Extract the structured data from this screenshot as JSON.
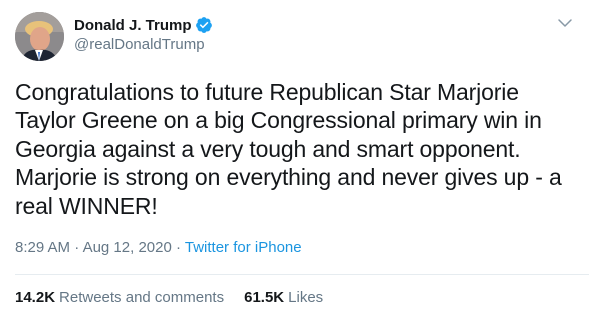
{
  "user": {
    "display_name": "Donald J. Trump",
    "handle": "@realDonaldTrump",
    "verified_icon": "verified-badge-icon",
    "avatar_icon": "profile-avatar"
  },
  "tweet": {
    "text": "Congratulations to future Republican Star Marjorie\nTaylor Greene on a big Congressional primary win in\nGeorgia against a very tough and smart opponent.\nMarjorie is strong on everything and never gives up - a\nreal WINNER!"
  },
  "meta": {
    "time": "8:29 AM",
    "separator": " · ",
    "date": "Aug 12, 2020",
    "source": "Twitter for iPhone"
  },
  "stats": {
    "retweets_count": "14.2K",
    "retweets_label": "Retweets and comments",
    "likes_count": "61.5K",
    "likes_label": "Likes"
  },
  "colors": {
    "accent": "#1b95e0",
    "secondary_text": "#657786",
    "primary_text": "#14171a",
    "verified": "#1da1f2"
  }
}
